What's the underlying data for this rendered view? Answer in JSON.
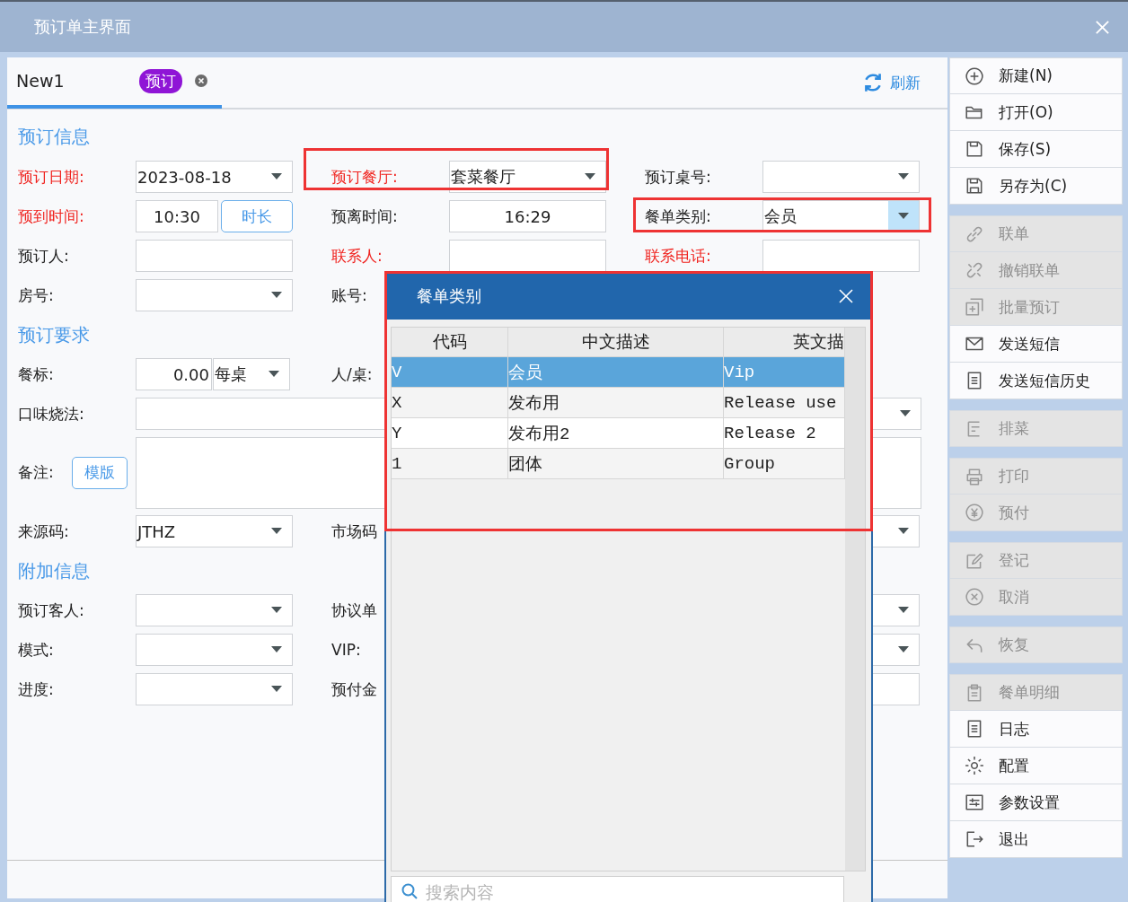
{
  "window": {
    "title": "预订单主界面"
  },
  "tab": {
    "label": "New1",
    "badge": "预订",
    "selected": true
  },
  "refresh": "刷新",
  "sections": [
    {
      "title": "预订信息",
      "rows": [
        {
          "fields": [
            {
              "label": "预订日期:",
              "required": true,
              "kind": "select",
              "value": "2023-08-18"
            },
            {
              "label": "预订餐厅:",
              "required": true,
              "kind": "select",
              "value": "套菜餐厅",
              "highlighted": true
            },
            {
              "label": "预订桌号:",
              "required": false,
              "kind": "select"
            }
          ]
        },
        {
          "fields": [
            {
              "label": "预到时间:",
              "required": true,
              "kind": "time",
              "value": "10:30",
              "button": "时长"
            },
            {
              "label": "预离时间:",
              "required": false,
              "kind": "input",
              "value": "16:29"
            },
            {
              "label": "餐单类别:",
              "required": false,
              "kind": "select",
              "value": "会员",
              "highlighted": true,
              "open": true
            }
          ]
        },
        {
          "fields": [
            {
              "label": "预订人:",
              "required": false,
              "kind": "input"
            },
            {
              "label": "联系人:",
              "required": true,
              "kind": "input"
            },
            {
              "label": "联系电话:",
              "required": true,
              "kind": "input"
            }
          ]
        },
        {
          "fields": [
            {
              "label": "房号:",
              "required": false,
              "kind": "select"
            },
            {
              "label": "账号:",
              "required": false,
              "kind": "label"
            }
          ]
        }
      ]
    },
    {
      "title": "预订要求",
      "rows": [
        {
          "fields": [
            {
              "label": "餐标:",
              "required": false,
              "kind": "amount",
              "value": "0.00",
              "unit": "每桌"
            },
            {
              "label": "人/桌:",
              "required": false,
              "kind": "label"
            }
          ]
        },
        {
          "fields": [
            {
              "label": "口味烧法:",
              "required": false,
              "kind": "wide_select"
            }
          ]
        },
        {
          "fields": [
            {
              "label": "备注:",
              "required": false,
              "kind": "textarea",
              "button": "模版"
            }
          ]
        },
        {
          "fields": [
            {
              "label": "来源码:",
              "required": false,
              "kind": "select",
              "value": "JTHZ"
            },
            {
              "label": "市场码",
              "required": false,
              "kind": "label"
            },
            {
              "kind": "select"
            }
          ]
        }
      ]
    },
    {
      "title": "附加信息",
      "rows": [
        {
          "fields": [
            {
              "label": "预订客人:",
              "required": false,
              "kind": "select"
            },
            {
              "label": "协议单",
              "required": false,
              "kind": "label"
            },
            {
              "kind": "select"
            }
          ]
        },
        {
          "fields": [
            {
              "label": "模式:",
              "required": false,
              "kind": "select"
            },
            {
              "label": "VIP:",
              "required": false,
              "kind": "label"
            },
            {
              "kind": "select"
            }
          ]
        },
        {
          "fields": [
            {
              "label": "进度:",
              "required": false,
              "kind": "select"
            },
            {
              "label": "预付金",
              "required": false,
              "kind": "label"
            },
            {
              "kind": "input"
            }
          ]
        }
      ]
    }
  ],
  "popup": {
    "title": "餐单类别",
    "highlighted": true,
    "columns": [
      "代码",
      "中文描述",
      "英文描"
    ],
    "rows": [
      {
        "cells": [
          "V",
          "会员",
          "Vip"
        ],
        "selected": true
      },
      {
        "cells": [
          "X",
          "发布用",
          "Release use"
        ],
        "selected": false
      },
      {
        "cells": [
          "Y",
          "发布用2",
          "Release 2"
        ],
        "selected": false
      },
      {
        "cells": [
          "1",
          "团体",
          "Group"
        ],
        "selected": false
      }
    ],
    "search": {
      "placeholder": "搜索内容"
    }
  },
  "sidebar": {
    "groups": [
      [
        {
          "label": "新建(N)",
          "disabled": false
        },
        {
          "label": "打开(O)",
          "disabled": false
        },
        {
          "label": "保存(S)",
          "disabled": false
        },
        {
          "label": "另存为(C)",
          "disabled": false
        }
      ],
      [
        {
          "label": "联单",
          "disabled": true
        },
        {
          "label": "撤销联单",
          "disabled": true
        },
        {
          "label": "批量预订",
          "disabled": true
        },
        {
          "label": "发送短信",
          "disabled": false
        },
        {
          "label": "发送短信历史",
          "disabled": false
        }
      ],
      [
        {
          "label": "排菜",
          "disabled": true
        }
      ],
      [
        {
          "label": "打印",
          "disabled": true
        },
        {
          "label": "预付",
          "disabled": true
        }
      ],
      [
        {
          "label": "登记",
          "disabled": true
        },
        {
          "label": "取消",
          "disabled": true
        }
      ],
      [
        {
          "label": "恢复",
          "disabled": true
        }
      ],
      [
        {
          "label": "餐单明细",
          "disabled": true
        },
        {
          "label": "日志",
          "disabled": false
        },
        {
          "label": "配置",
          "disabled": false
        },
        {
          "label": "参数设置",
          "disabled": false
        },
        {
          "label": "退出",
          "disabled": false
        }
      ]
    ]
  }
}
